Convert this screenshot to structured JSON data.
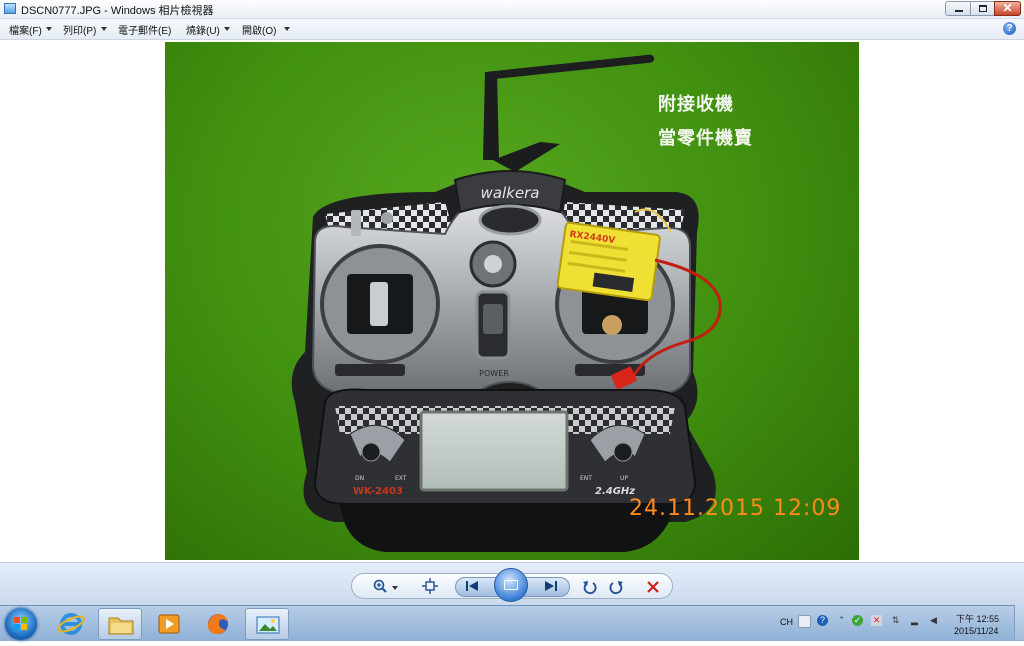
{
  "window": {
    "title": "DSCN0777.JPG - Windows 相片檢視器",
    "close_label": "✕"
  },
  "menu": {
    "items": [
      {
        "label": "檔案(F)"
      },
      {
        "label": "列印(P)"
      },
      {
        "label": "電子郵件(E)"
      },
      {
        "label": "燒錄(U)"
      },
      {
        "label": "開啟(O)"
      }
    ],
    "help_label": "?"
  },
  "photo": {
    "overlay_line1": "附接收機",
    "overlay_line2": "當零件機賣",
    "date_stamp": "24.11.2015  12:09",
    "transmitter_brand": "walkera",
    "receiver_label": "RX2440V",
    "power_label": "POWER",
    "model_label": "WK-2403",
    "frequency_label": "2.4GHz",
    "key_left1": "DN",
    "key_left2": "EXT",
    "key_right1": "ENT",
    "key_right2": "UP"
  },
  "toolbar": {
    "zoom_icon": "magnifier-icon",
    "fit_icon": "actual-size-icon",
    "prev_icon": "previous-icon",
    "slideshow_icon": "slideshow-icon",
    "next_icon": "next-icon",
    "rotate_ccw_icon": "rotate-counterclockwise-icon",
    "rotate_cw_icon": "rotate-clockwise-icon",
    "delete_icon": "delete-icon"
  },
  "taskbar": {
    "apps": [
      "start-orb",
      "internet-explorer",
      "file-explorer",
      "media-player",
      "firefox",
      "photo-viewer"
    ],
    "language": "CH",
    "time": "下午 12:55",
    "date": "2015/11/24"
  }
}
